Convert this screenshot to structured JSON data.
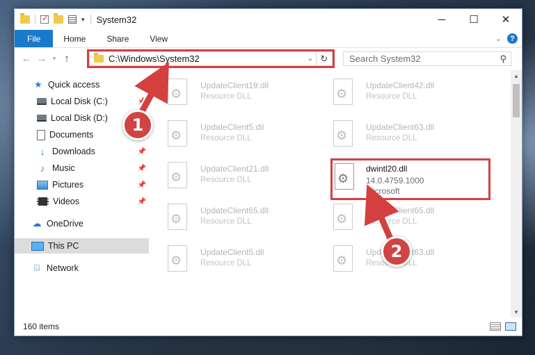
{
  "window": {
    "title": "System32",
    "controls": {
      "minimize": "─",
      "maximize": "☐",
      "close": "✕"
    }
  },
  "quick_access_toolbar": {
    "icons": [
      "folder-icon",
      "properties-check-icon",
      "new-folder-icon",
      "properties-list-icon"
    ],
    "dropdown": "▾"
  },
  "ribbon": {
    "tabs": [
      "File",
      "Home",
      "Share",
      "View"
    ],
    "expand": "⌄",
    "help": "?"
  },
  "navigation": {
    "back": "←",
    "forward": "→",
    "recent": "▾",
    "up": "↑",
    "address": "C:\\Windows\\System32",
    "address_dropdown": "⌄",
    "refresh": "↻",
    "search_placeholder": "Search System32",
    "search_icon": "⚲"
  },
  "sidebar": {
    "items": [
      {
        "label": "Quick access",
        "icon": "star-icon",
        "glyph": "★",
        "pinned": false
      },
      {
        "label": "Local Disk (C:)",
        "icon": "drive-icon",
        "glyph": "",
        "pinned": true
      },
      {
        "label": "Local Disk (D:)",
        "icon": "drive-icon",
        "glyph": "",
        "pinned": false
      },
      {
        "label": "Documents",
        "icon": "documents-icon",
        "glyph": "",
        "pinned": true
      },
      {
        "label": "Downloads",
        "icon": "download-icon",
        "glyph": "↓",
        "pinned": true
      },
      {
        "label": "Music",
        "icon": "music-icon",
        "glyph": "♪",
        "pinned": true
      },
      {
        "label": "Pictures",
        "icon": "pictures-icon",
        "glyph": "",
        "pinned": true
      },
      {
        "label": "Videos",
        "icon": "videos-icon",
        "glyph": "",
        "pinned": true
      },
      {
        "label": "OneDrive",
        "icon": "cloud-icon",
        "glyph": "☁",
        "pinned": false
      },
      {
        "label": "This PC",
        "icon": "computer-icon",
        "glyph": "",
        "pinned": false,
        "selected": true
      },
      {
        "label": "Network",
        "icon": "network-icon",
        "glyph": "⌸",
        "pinned": false
      }
    ],
    "pin_glyph": "📌"
  },
  "files": [
    {
      "name": "UpdateClient19.dll",
      "type": "Resource DLL"
    },
    {
      "name": "UpdateClient42.dll",
      "type": "Resource DLL"
    },
    {
      "name": "UpdateClient5.dll",
      "type": "Resource DLL"
    },
    {
      "name": "UpdateClient63.dll",
      "type": "Resource DLL"
    },
    {
      "name": "UpdateClient21.dll",
      "type": "Resource DLL"
    },
    {
      "name": "dwintl20.dll",
      "version": "14.0.4759.1000",
      "publisher": "Microsoft",
      "highlighted": true
    },
    {
      "name": "UpdateClient65.dll",
      "type": "Resource DLL"
    },
    {
      "name": "UpdateClient65.dll",
      "type": "Resource DLL"
    },
    {
      "name": "UpdateClient5.dll",
      "type": "Resource DLL"
    },
    {
      "name": "UpdateClient63.dll",
      "type": "Resource DLL"
    }
  ],
  "status": {
    "item_count": "160 items"
  },
  "scrollbar": {
    "up": "▲",
    "down": "▼"
  },
  "annotations": {
    "markers": [
      "1",
      "2"
    ],
    "highlight_color": "#d44040"
  }
}
